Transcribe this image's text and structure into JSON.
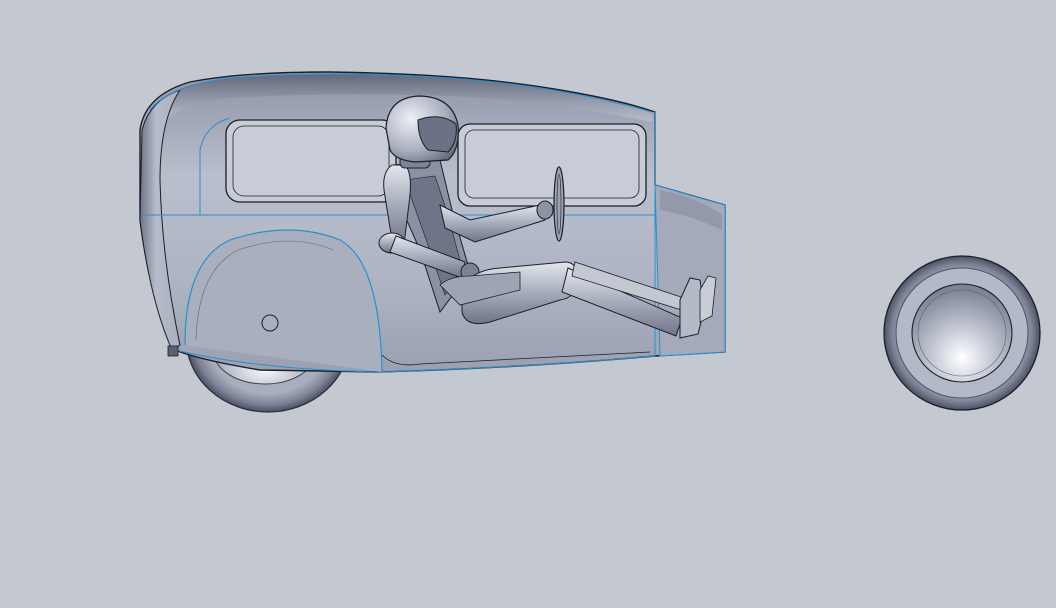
{
  "viewport": {
    "background_color": "#c3c8d1",
    "model_fill_color": "#aab0c0",
    "edge_highlight_color": "#2a8fd0",
    "outline_color": "#1c1f26"
  },
  "scene": {
    "objects": [
      "car-body",
      "rear-wheel",
      "driver-mannequin",
      "steering-wheel",
      "detached-front-wheel"
    ]
  }
}
